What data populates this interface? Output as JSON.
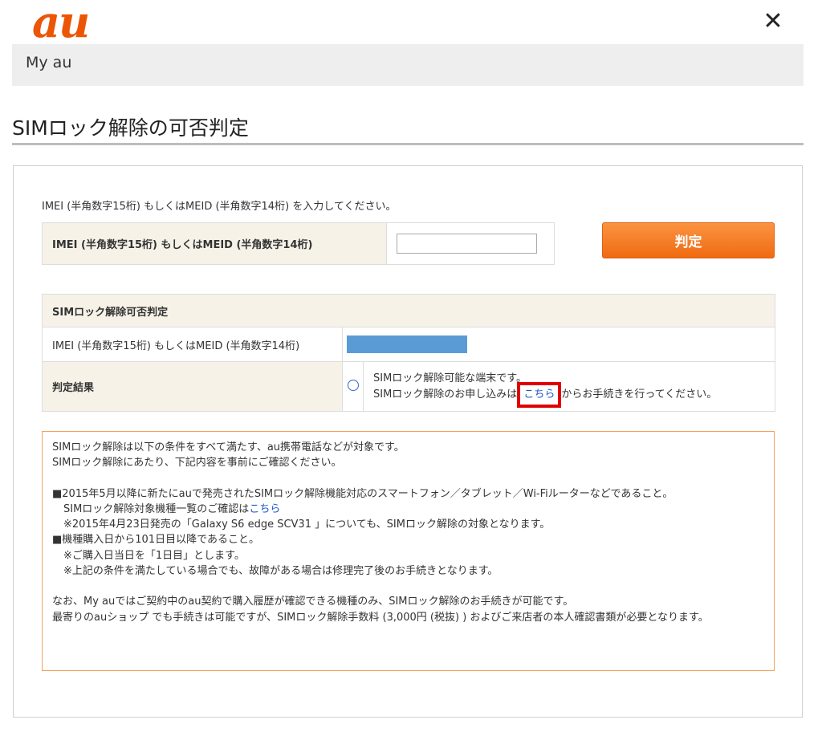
{
  "header": {
    "logo_text": "au",
    "close_symbol": "✕",
    "bar_label": "My au"
  },
  "page": {
    "title": "SIMロック解除の可否判定"
  },
  "form": {
    "instruction": "IMEI (半角数字15桁) もしくはMEID (半角数字14桁) を入力してください。",
    "field_label": "IMEI (半角数字15桁) もしくはMEID (半角数字14桁)",
    "field_value": "",
    "button_label": "判定"
  },
  "result": {
    "heading": "SIMロック解除可否判定",
    "imei_label": "IMEI (半角数字15桁) もしくはMEID (半角数字14桁)",
    "result_label": "判定結果",
    "line1": "SIMロック解除可能な端末です。",
    "line2_pre": "SIMロック解除のお申し込みは",
    "line2_link": "こちら",
    "line2_post": "からお手続きを行ってください。"
  },
  "notice": {
    "p1": "SIMロック解除は以下の条件をすべて満たす、au携帯電話などが対象です。",
    "p2": "SIMロック解除にあたり、下記内容を事前にご確認ください。",
    "b1": "■2015年5月以降に新たにauで発売されたSIMロック解除機能対応のスマートフォン／タブレット／Wi-Fiルーターなどであること。",
    "b1_sub1_pre": "SIMロック解除対象機種一覧のご確認は",
    "b1_sub1_link": "こちら",
    "b1_sub2": "※2015年4月23日発売の「Galaxy S6 edge SCV31 」についても、SIMロック解除の対象となります。",
    "b2": "■機種購入日から101日目以降であること。",
    "b2_sub1": "※ご購入日当日を「1日目」とします。",
    "b2_sub2": "※上記の条件を満たしている場合でも、故障がある場合は修理完了後のお手続きとなります。",
    "p3": "なお、My auではご契約中のau契約で購入履歴が確認できる機種のみ、SIMロック解除のお手続きが可能です。",
    "p4": "最寄りのauショップ でも手続きは可能ですが、SIMロック解除手数料 (3,000円 (税抜) ) およびご来店者の本人確認書類が必要となります。"
  }
}
